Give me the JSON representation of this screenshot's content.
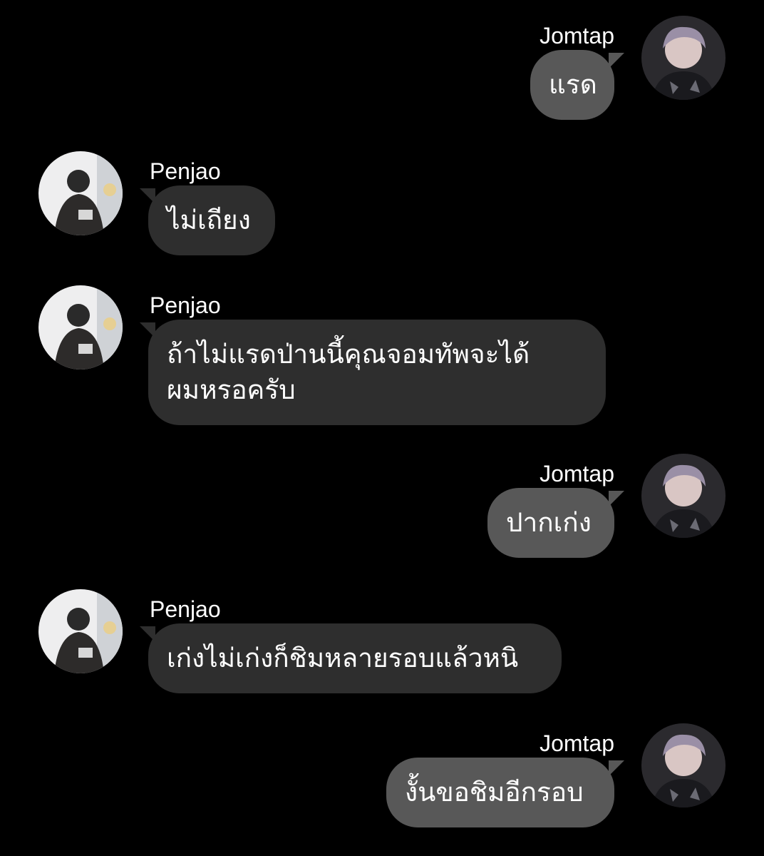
{
  "chat": {
    "messages": [
      {
        "sender": "Jomtap",
        "side": "out",
        "text": "แรด"
      },
      {
        "sender": "Penjao",
        "side": "in",
        "text": "ไม่เถียง"
      },
      {
        "sender": "Penjao",
        "side": "in",
        "text": "ถ้าไม่แรดป่านนี้คุณจอมทัพจะได้\nผมหรอครับ"
      },
      {
        "sender": "Jomtap",
        "side": "out",
        "text": "ปากเก่ง"
      },
      {
        "sender": "Penjao",
        "side": "in",
        "text": "เก่งไม่เก่งก็ชิมหลายรอบแล้วหนิ"
      },
      {
        "sender": "Jomtap",
        "side": "out",
        "text": "งั้นขอชิมอีกรอบ"
      }
    ]
  },
  "colors": {
    "background": "#000000",
    "incoming_bubble": "#2e2e2e",
    "outgoing_bubble": "#585858",
    "text": "#ffffff"
  },
  "icons": {
    "jomtap_avatar": "avatar-photo-icon",
    "penjao_avatar": "avatar-photo-icon"
  }
}
